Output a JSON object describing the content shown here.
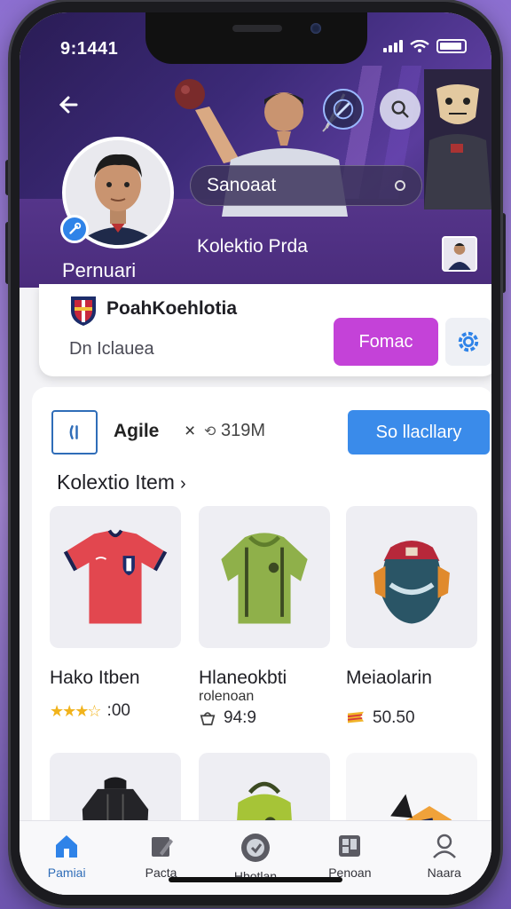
{
  "status_bar": {
    "time": "9:1441"
  },
  "header": {
    "search_text": "Sanoaat",
    "profile_name": "Pernuari",
    "subtitle": "Kolektio Prda"
  },
  "club": {
    "name": "PoahKoehlotia",
    "subtitle": "Dn  Iclauea",
    "follow_label": "Fomac"
  },
  "filter": {
    "label": "Agile",
    "close": "×",
    "count": "319M",
    "sort_label": "So llacllary"
  },
  "collection": {
    "title": "Kolextio Item",
    "chevron": "›",
    "items": [
      {
        "name": "Hako Itben",
        "sub": "",
        "meta": ":00",
        "icon": "stars"
      },
      {
        "name": "Hlaneokbti",
        "sub": "rolenoan",
        "meta": "94:9",
        "icon": "bag-icon"
      },
      {
        "name": "Meiaolarin",
        "sub": "",
        "meta": "50.50",
        "icon": "flag-icon"
      }
    ]
  },
  "bottom_nav": [
    {
      "label": "Pamiai",
      "icon": "home-icon",
      "active": true
    },
    {
      "label": "Pacta",
      "icon": "edit-icon",
      "active": false
    },
    {
      "label": "Hbotlan",
      "icon": "badge-icon",
      "active": false
    },
    {
      "label": "Penoan",
      "icon": "dashboard-icon",
      "active": false
    },
    {
      "label": "Naara",
      "icon": "profile-icon",
      "active": false
    }
  ],
  "colors": {
    "accent_blue": "#3a8bea",
    "follow_magenta": "#c442d8",
    "header_purple": "#3c2a78"
  }
}
